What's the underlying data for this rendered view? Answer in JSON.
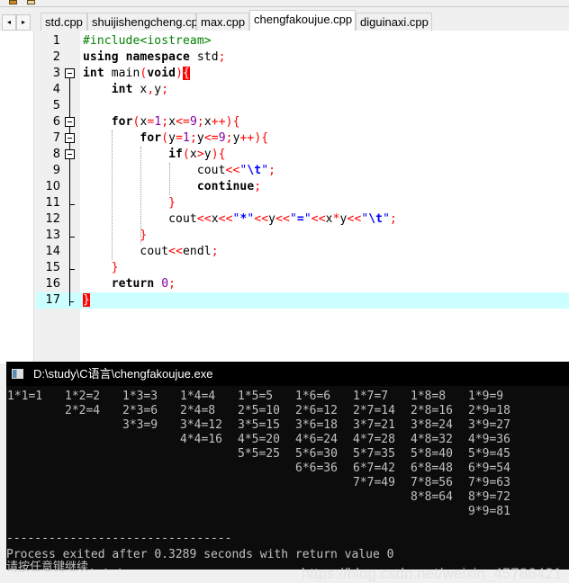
{
  "tabs": [
    {
      "label": "std.cpp",
      "active": false
    },
    {
      "label": "shuijishengcheng.cpp",
      "active": false
    },
    {
      "label": "max.cpp",
      "active": false
    },
    {
      "label": "chengfakoujue.cpp",
      "active": true
    },
    {
      "label": "diguinaxi.cpp",
      "active": false
    }
  ],
  "nav": {
    "prev": "◂",
    "next": "▸"
  },
  "editor": {
    "current_line": 17,
    "lines": [
      [
        [
          "#include<iostream>",
          "p"
        ]
      ],
      [
        [
          "using",
          "k"
        ],
        [
          " ",
          "t"
        ],
        [
          "namespace",
          "k"
        ],
        [
          " std",
          "t"
        ],
        [
          ";",
          "o"
        ]
      ],
      [
        [
          "int",
          "k"
        ],
        [
          " main",
          "t"
        ],
        [
          "(",
          "o"
        ],
        [
          "void",
          "k"
        ],
        [
          ")",
          "o"
        ],
        [
          "{",
          "b"
        ]
      ],
      [
        [
          "    ",
          "t"
        ],
        [
          "int",
          "k"
        ],
        [
          " x",
          "t"
        ],
        [
          ",",
          "o"
        ],
        [
          "y",
          "t"
        ],
        [
          ";",
          "o"
        ]
      ],
      [],
      [
        [
          "    ",
          "t"
        ],
        [
          "for",
          "k"
        ],
        [
          "(",
          "o"
        ],
        [
          "x",
          "t"
        ],
        [
          "=",
          "o"
        ],
        [
          "1",
          "n"
        ],
        [
          ";",
          "o"
        ],
        [
          "x",
          "t"
        ],
        [
          "<=",
          "o"
        ],
        [
          "9",
          "n"
        ],
        [
          ";",
          "o"
        ],
        [
          "x",
          "t"
        ],
        [
          "++",
          "o"
        ],
        [
          "){",
          "o"
        ]
      ],
      [
        [
          "        ",
          "t"
        ],
        [
          "for",
          "k"
        ],
        [
          "(",
          "o"
        ],
        [
          "y",
          "t"
        ],
        [
          "=",
          "o"
        ],
        [
          "1",
          "n"
        ],
        [
          ";",
          "o"
        ],
        [
          "y",
          "t"
        ],
        [
          "<=",
          "o"
        ],
        [
          "9",
          "n"
        ],
        [
          ";",
          "o"
        ],
        [
          "y",
          "t"
        ],
        [
          "++",
          "o"
        ],
        [
          "){",
          "o"
        ]
      ],
      [
        [
          "            ",
          "t"
        ],
        [
          "if",
          "k"
        ],
        [
          "(",
          "o"
        ],
        [
          "x",
          "t"
        ],
        [
          ">",
          "o"
        ],
        [
          "y",
          "t"
        ],
        [
          "){",
          "o"
        ]
      ],
      [
        [
          "                ",
          "t"
        ],
        [
          "cout",
          "t"
        ],
        [
          "<<",
          "o"
        ],
        [
          "\"",
          "s"
        ],
        [
          "\\t",
          "e"
        ],
        [
          "\"",
          "s"
        ],
        [
          ";",
          "o"
        ]
      ],
      [
        [
          "                ",
          "t"
        ],
        [
          "continue",
          "k"
        ],
        [
          ";",
          "o"
        ]
      ],
      [
        [
          "            ",
          "t"
        ],
        [
          "}",
          "o"
        ]
      ],
      [
        [
          "            ",
          "t"
        ],
        [
          "cout",
          "t"
        ],
        [
          "<<",
          "o"
        ],
        [
          "x",
          "t"
        ],
        [
          "<<",
          "o"
        ],
        [
          "\"",
          "s"
        ],
        [
          "*",
          "e"
        ],
        [
          "\"",
          "s"
        ],
        [
          "<<",
          "o"
        ],
        [
          "y",
          "t"
        ],
        [
          "<<",
          "o"
        ],
        [
          "\"",
          "s"
        ],
        [
          "=",
          "e"
        ],
        [
          "\"",
          "s"
        ],
        [
          "<<",
          "o"
        ],
        [
          "x",
          "t"
        ],
        [
          "*",
          "o"
        ],
        [
          "y",
          "t"
        ],
        [
          "<<",
          "o"
        ],
        [
          "\"",
          "s"
        ],
        [
          "\\t",
          "e"
        ],
        [
          "\"",
          "s"
        ],
        [
          ";",
          "o"
        ]
      ],
      [
        [
          "        ",
          "t"
        ],
        [
          "}",
          "o"
        ]
      ],
      [
        [
          "        ",
          "t"
        ],
        [
          "cout",
          "t"
        ],
        [
          "<<",
          "o"
        ],
        [
          "endl",
          "t"
        ],
        [
          ";",
          "o"
        ]
      ],
      [
        [
          "    ",
          "t"
        ],
        [
          "}",
          "o"
        ]
      ],
      [
        [
          "    ",
          "t"
        ],
        [
          "return",
          "k"
        ],
        [
          " ",
          "t"
        ],
        [
          "0",
          "n"
        ],
        [
          ";",
          "o"
        ]
      ],
      [
        [
          "}",
          "b"
        ]
      ]
    ]
  },
  "console": {
    "title": "D:\\study\\C语言\\chengfakoujue.exe",
    "table": [
      [
        "1*1=1",
        "1*2=2",
        "1*3=3",
        "1*4=4",
        "1*5=5",
        "1*6=6",
        "1*7=7",
        "1*8=8",
        "1*9=9"
      ],
      [
        "",
        "2*2=4",
        "2*3=6",
        "2*4=8",
        "2*5=10",
        "2*6=12",
        "2*7=14",
        "2*8=16",
        "2*9=18"
      ],
      [
        "",
        "",
        "3*3=9",
        "3*4=12",
        "3*5=15",
        "3*6=18",
        "3*7=21",
        "3*8=24",
        "3*9=27"
      ],
      [
        "",
        "",
        "",
        "4*4=16",
        "4*5=20",
        "4*6=24",
        "4*7=28",
        "4*8=32",
        "4*9=36"
      ],
      [
        "",
        "",
        "",
        "",
        "5*5=25",
        "5*6=30",
        "5*7=35",
        "5*8=40",
        "5*9=45"
      ],
      [
        "",
        "",
        "",
        "",
        "",
        "6*6=36",
        "6*7=42",
        "6*8=48",
        "6*9=54"
      ],
      [
        "",
        "",
        "",
        "",
        "",
        "",
        "7*7=49",
        "7*8=56",
        "7*9=63"
      ],
      [
        "",
        "",
        "",
        "",
        "",
        "",
        "",
        "8*8=64",
        "8*9=72"
      ],
      [
        "",
        "",
        "",
        "",
        "",
        "",
        "",
        "",
        "9*9=81"
      ]
    ],
    "separator": "--------------------------------",
    "process_line": "Process exited after 0.3289 seconds with return value 0",
    "press_key": "请按任意键继续. . ."
  },
  "watermark": "https://blog.csdn.net/weixin_45786421"
}
